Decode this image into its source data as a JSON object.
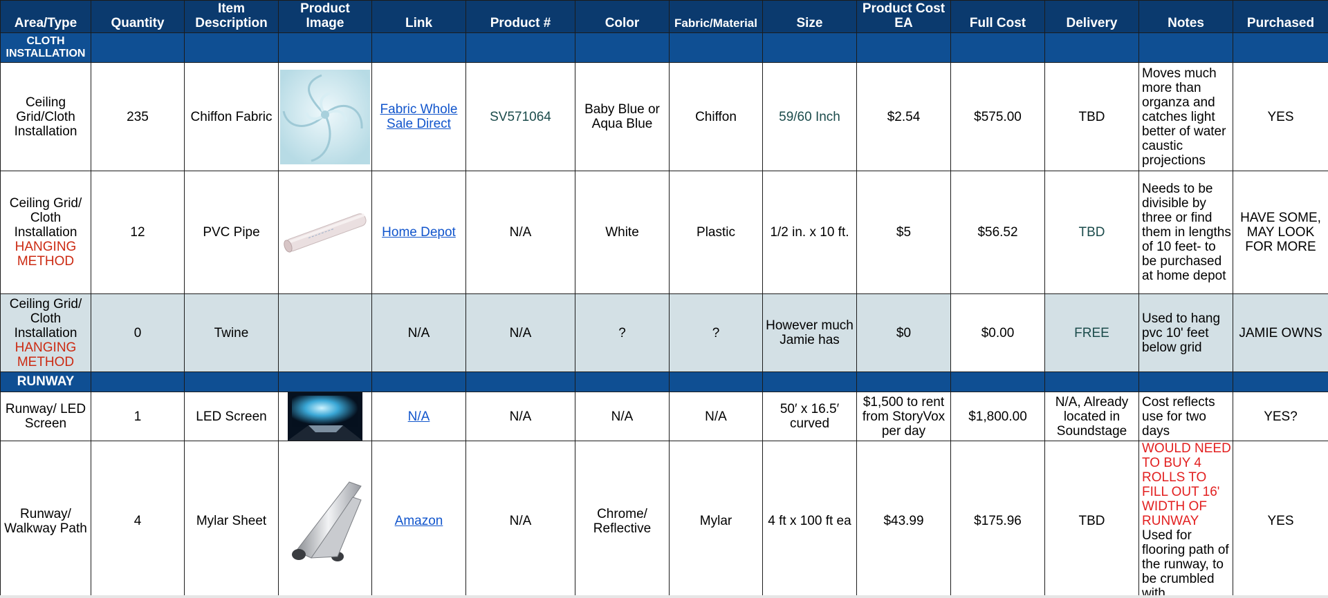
{
  "headers": [
    "Area/Type",
    "Quantity",
    "Item Description",
    "Product Image",
    "Link",
    "Product #",
    "Color",
    "Fabric/Material",
    "Size",
    "Product Cost EA",
    "Full Cost",
    "Delivery",
    "Notes",
    "Purchased"
  ],
  "sections": {
    "cloth": "CLOTH INSTALLATION",
    "runway": "RUNWAY"
  },
  "rows": [
    {
      "area": "Ceiling Grid/Cloth Installation",
      "area_red": "",
      "quantity": "235",
      "item": "Chiffon Fabric",
      "image_icon": "chiffon-fabric-image",
      "link": "Fabric Whole Sale Direct",
      "product_no": "SV571064",
      "color": "Baby Blue or Aqua Blue",
      "material": "Chiffon",
      "size": "59/60 Inch",
      "cost_ea": "$2.54",
      "full_cost": "$575.00",
      "delivery": "TBD",
      "notes_red": "",
      "notes": "Moves much more than organza and catches light better of water caustic projections",
      "purchased": "YES"
    },
    {
      "area": "Ceiling Grid/ Cloth Installation",
      "area_red": "HANGING METHOD",
      "quantity": "12",
      "item": "PVC Pipe",
      "image_icon": "pvc-pipe-image",
      "link": "Home Depot",
      "product_no": "N/A",
      "color": "White",
      "material": "Plastic",
      "size": "1/2 in. x 10 ft.",
      "cost_ea": "$5",
      "full_cost": "$56.52",
      "delivery": "TBD",
      "notes_red": "",
      "notes": "Needs to be divisible by three or find them in lengths of 10 feet- to be purchased at home depot",
      "purchased": "HAVE SOME, MAY LOOK FOR MORE"
    },
    {
      "area": "Ceiling Grid/ Cloth Installation",
      "area_red": "HANGING METHOD",
      "quantity": "0",
      "item": "Twine",
      "image_icon": "",
      "link": "N/A",
      "product_no": "N/A",
      "color": "?",
      "material": "?",
      "size": "However much Jamie has",
      "cost_ea": "$0",
      "full_cost": "$0.00",
      "delivery": "FREE",
      "notes_red": "",
      "notes": "Used to hang pvc 10' feet below grid",
      "purchased": "JAMIE OWNS"
    },
    {
      "area": "Runway/ LED Screen",
      "area_red": "",
      "quantity": "1",
      "item": "LED Screen",
      "image_icon": "led-screen-image",
      "link": "N/A",
      "product_no": "N/A",
      "color": "N/A",
      "material": "N/A",
      "size": "50′ x 16.5′ curved",
      "cost_ea": "$1,500 to rent from StoryVox per day",
      "full_cost": "$1,800.00",
      "delivery": "N/A, Already located in Soundstage",
      "notes_red": "",
      "notes": "Cost reflects use for two days",
      "purchased": "YES?"
    },
    {
      "area": "Runway/ Walkway Path",
      "area_red": "",
      "quantity": "4",
      "item": "Mylar Sheet",
      "image_icon": "mylar-sheet-image",
      "link": "Amazon",
      "product_no": "N/A",
      "color": "Chrome/ Reflective",
      "material": "Mylar",
      "size": "4 ft x 100 ft ea",
      "cost_ea": "$43.99",
      "full_cost": "$175.96",
      "delivery": "TBD",
      "notes_red": "WOULD NEED TO BUY 4 ROLLS TO FILL OUT 16' WIDTH OF RUNWAY",
      "notes": " Used for flooring path of the runway, to be crumbled with",
      "purchased": "YES"
    }
  ],
  "colors": {
    "header_bg": "#0b3a6e",
    "section_bg": "#0f4f93",
    "shaded_row": "#d3e0e5",
    "hanging_red": "#cc2a12",
    "notes_red": "#e21f1f",
    "link_blue": "#1155cc"
  }
}
